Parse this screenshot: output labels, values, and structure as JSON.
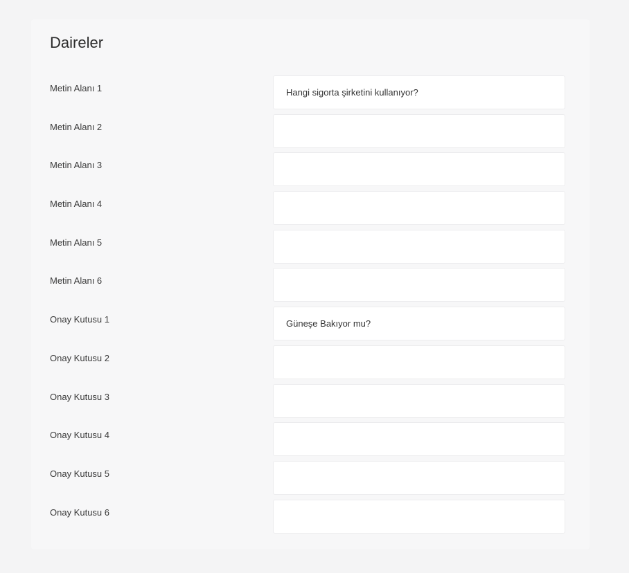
{
  "panel": {
    "title": "Daireler"
  },
  "fields": [
    {
      "label": "Metin Alanı 1",
      "value": "Hangi sigorta şirketini kullanıyor?"
    },
    {
      "label": "Metin Alanı 2",
      "value": ""
    },
    {
      "label": "Metin Alanı 3",
      "value": ""
    },
    {
      "label": "Metin Alanı 4",
      "value": ""
    },
    {
      "label": "Metin Alanı 5",
      "value": ""
    },
    {
      "label": "Metin Alanı 6",
      "value": ""
    },
    {
      "label": "Onay Kutusu 1",
      "value": "Güneşe Bakıyor mu?"
    },
    {
      "label": "Onay Kutusu 2",
      "value": ""
    },
    {
      "label": "Onay Kutusu 3",
      "value": ""
    },
    {
      "label": "Onay Kutusu 4",
      "value": ""
    },
    {
      "label": "Onay Kutusu 5",
      "value": ""
    },
    {
      "label": "Onay Kutusu 6",
      "value": ""
    }
  ]
}
